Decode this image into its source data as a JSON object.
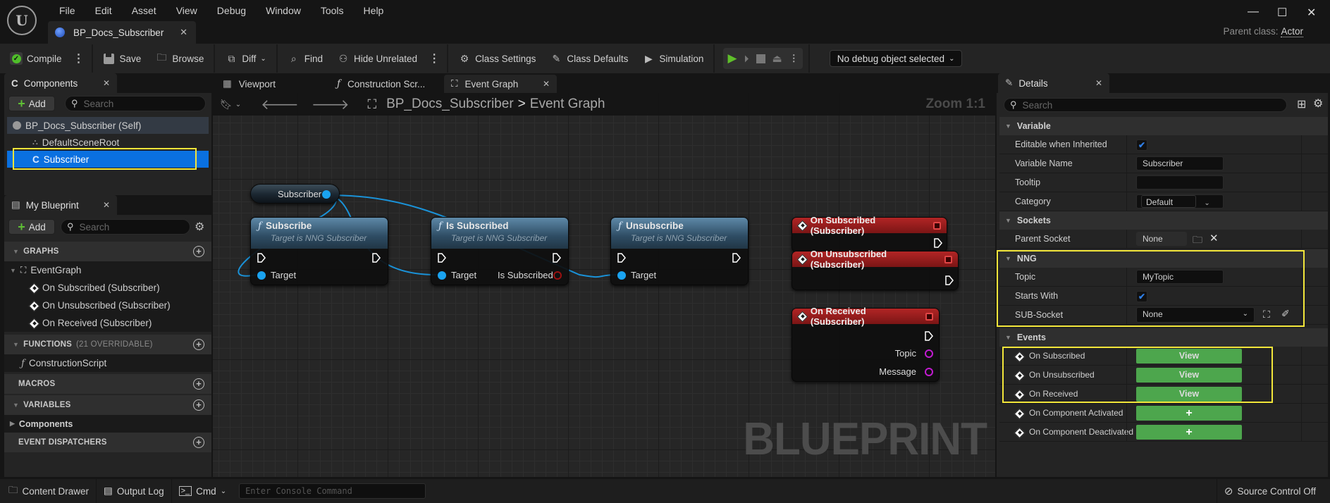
{
  "app": {
    "menu": [
      "File",
      "Edit",
      "Asset",
      "View",
      "Debug",
      "Window",
      "Tools",
      "Help"
    ],
    "document_tab": "BP_Docs_Subscriber",
    "parent_class_label": "Parent class:",
    "parent_class_value": "Actor",
    "window_controls": {
      "minimize": "—",
      "maximize": "☐",
      "close": "✕"
    }
  },
  "toolbar": {
    "compile": "Compile",
    "save": "Save",
    "browse": "Browse",
    "diff": "Diff",
    "find": "Find",
    "hide_unrelated": "Hide Unrelated",
    "class_settings": "Class Settings",
    "class_defaults": "Class Defaults",
    "simulation": "Simulation",
    "debug_object": "No debug object selected"
  },
  "components_panel": {
    "title": "Components",
    "add_label": "Add",
    "search_placeholder": "Search",
    "tree": [
      {
        "label": "BP_Docs_Subscriber (Self)",
        "level": 0,
        "selected": false
      },
      {
        "label": "DefaultSceneRoot",
        "level": 1,
        "selected": false
      },
      {
        "label": "Subscriber",
        "level": 1,
        "selected": true
      }
    ]
  },
  "my_blueprint": {
    "title": "My Blueprint",
    "add_label": "Add",
    "search_placeholder": "Search",
    "graphs_header": "GRAPHS",
    "event_graph": "EventGraph",
    "graph_events": [
      "On Subscribed (Subscriber)",
      "On Unsubscribed (Subscriber)",
      "On Received (Subscriber)"
    ],
    "functions_header": "FUNCTIONS",
    "functions_count": "(21 OVERRIDABLE)",
    "functions": [
      "ConstructionScript"
    ],
    "macros_header": "MACROS",
    "variables_header": "VARIABLES",
    "variable_groups": [
      "Components"
    ],
    "dispatchers_header": "EVENT DISPATCHERS"
  },
  "graph_tabs": [
    "Viewport",
    "Construction Scr...",
    "Event Graph"
  ],
  "graph": {
    "breadcrumb_root": "BP_Docs_Subscriber",
    "breadcrumb_sep": ">",
    "breadcrumb_current": "Event Graph",
    "zoom": "Zoom 1:1",
    "watermark": "BLUEPRINT",
    "variable_node": "Subscriber",
    "function_nodes": [
      {
        "title": "Subscribe",
        "subtitle": "Target is NNG Subscriber",
        "pin": "Target",
        "output": ""
      },
      {
        "title": "Is Subscribed",
        "subtitle": "Target is NNG Subscriber",
        "pin": "Target",
        "output": "Is Subscribed"
      },
      {
        "title": "Unsubscribe",
        "subtitle": "Target is NNG Subscriber",
        "pin": "Target",
        "output": ""
      }
    ],
    "event_nodes": [
      {
        "title": "On Subscribed (Subscriber)",
        "outputs": []
      },
      {
        "title": "On Unsubscribed (Subscriber)",
        "outputs": []
      },
      {
        "title": "On Received (Subscriber)",
        "outputs": [
          "Topic",
          "Message"
        ]
      }
    ]
  },
  "details": {
    "title": "Details",
    "search_placeholder": "Search",
    "variable_section": "Variable",
    "editable_when_inherited_label": "Editable when Inherited",
    "editable_when_inherited": true,
    "variable_name_label": "Variable Name",
    "variable_name": "Subscriber",
    "tooltip_label": "Tooltip",
    "tooltip": "",
    "category_label": "Category",
    "category": "Default",
    "sockets_section": "Sockets",
    "parent_socket_label": "Parent Socket",
    "parent_socket": "None",
    "nng_section": "NNG",
    "topic_label": "Topic",
    "topic": "MyTopic",
    "starts_with_label": "Starts With",
    "starts_with": true,
    "sub_socket_label": "SUB-Socket",
    "sub_socket": "None",
    "events_section": "Events",
    "events": [
      {
        "label": "On Subscribed",
        "action": "View"
      },
      {
        "label": "On Unsubscribed",
        "action": "View"
      },
      {
        "label": "On Received",
        "action": "View"
      },
      {
        "label": "On Component Activated",
        "action": "+"
      },
      {
        "label": "On Component Deactivated",
        "action": "+"
      }
    ]
  },
  "statusbar": {
    "content_drawer": "Content Drawer",
    "output_log": "Output Log",
    "cmd": "Cmd",
    "console_placeholder": "Enter Console Command",
    "source_control": "Source Control Off"
  },
  "colors": {
    "highlight": "#f2e63a",
    "selection": "#0070e0",
    "function_header": "#3d627f",
    "event_header": "#a01c1c",
    "object_pin": "#1aa3f0",
    "string_pin": "#c21bd1",
    "view_button": "#4da64d"
  }
}
